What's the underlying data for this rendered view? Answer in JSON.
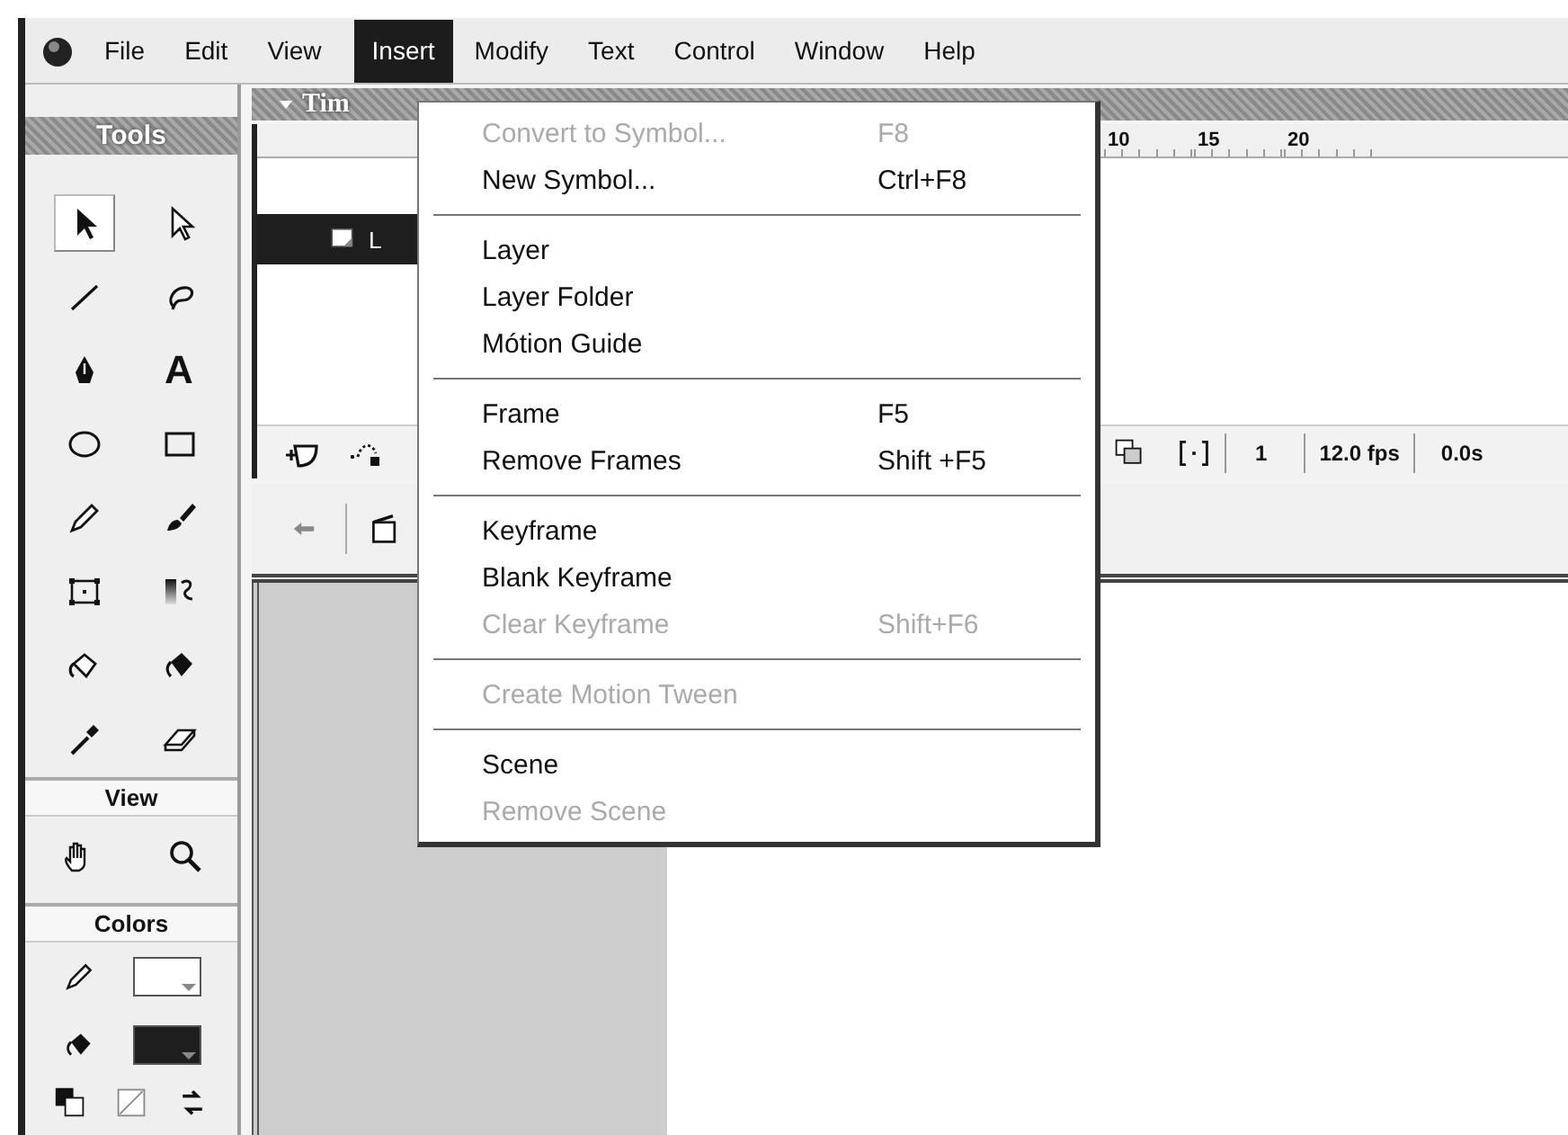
{
  "menubar": {
    "items": [
      {
        "label": "File",
        "selected": false
      },
      {
        "label": "Edit",
        "selected": false
      },
      {
        "label": "View",
        "selected": false
      },
      {
        "label": "Insert",
        "selected": true
      },
      {
        "label": "Modify",
        "selected": false
      },
      {
        "label": "Text",
        "selected": false
      },
      {
        "label": "Control",
        "selected": false
      },
      {
        "label": "Window",
        "selected": false
      },
      {
        "label": "Help",
        "selected": false
      }
    ]
  },
  "tools_panel": {
    "title": "Tools",
    "tools": [
      {
        "kind": "arrow",
        "selected": true
      },
      {
        "kind": "subselect",
        "selected": false
      },
      {
        "kind": "line",
        "selected": false
      },
      {
        "kind": "lasso",
        "selected": false
      },
      {
        "kind": "pen",
        "selected": false
      },
      {
        "kind": "text",
        "glyph": "A",
        "selected": false
      },
      {
        "kind": "oval",
        "selected": false
      },
      {
        "kind": "rect",
        "selected": false
      },
      {
        "kind": "pencil",
        "selected": false
      },
      {
        "kind": "brush",
        "selected": false
      },
      {
        "kind": "transform",
        "selected": false
      },
      {
        "kind": "fill_transform",
        "selected": false
      },
      {
        "kind": "ink",
        "selected": false
      },
      {
        "kind": "bucket",
        "selected": false
      },
      {
        "kind": "dropper",
        "selected": false
      },
      {
        "kind": "eraser",
        "selected": false
      }
    ],
    "view": {
      "title": "View",
      "tools": [
        {
          "kind": "hand",
          "selected": false
        },
        {
          "kind": "zoom",
          "selected": false
        }
      ]
    },
    "colors": {
      "title": "Colors",
      "stroke": {
        "color": "#ffffff"
      },
      "fill": {
        "color": "#1e1e1e"
      }
    }
  },
  "timeline": {
    "title": "Tim",
    "ruler": [
      "10",
      "15",
      "20"
    ],
    "layer": {
      "name": "L",
      "selected": true
    },
    "current_frame": "1",
    "frame_rate": "12.0 fps",
    "elapsed_time": "0.0s"
  },
  "insert_menu": {
    "groups": [
      {
        "items": [
          {
            "label": "Convert to Symbol...",
            "shortcut": "F8",
            "disabled": true
          },
          {
            "label": "New Symbol...",
            "shortcut": "Ctrl+F8",
            "disabled": false
          }
        ]
      },
      {
        "items": [
          {
            "label": "Layer",
            "disabled": false
          },
          {
            "label": "Layer Folder",
            "disabled": false
          },
          {
            "label": "Mótion Guide",
            "disabled": false
          }
        ]
      },
      {
        "items": [
          {
            "label": "Frame",
            "shortcut": "F5",
            "disabled": false
          },
          {
            "label": "Remove Frames",
            "shortcut": "Shift +F5",
            "disabled": false
          }
        ]
      },
      {
        "items": [
          {
            "label": "Keyframe",
            "disabled": false
          },
          {
            "label": "Blank Keyframe",
            "disabled": false
          },
          {
            "label": "Clear Keyframe",
            "shortcut": "Shift+F6",
            "disabled": true
          }
        ]
      },
      {
        "items": [
          {
            "label": "Create Motion Tween",
            "disabled": true
          }
        ]
      },
      {
        "items": [
          {
            "label": "Scene",
            "disabled": false
          },
          {
            "label": "Remove Scene",
            "disabled": true
          }
        ]
      }
    ]
  }
}
